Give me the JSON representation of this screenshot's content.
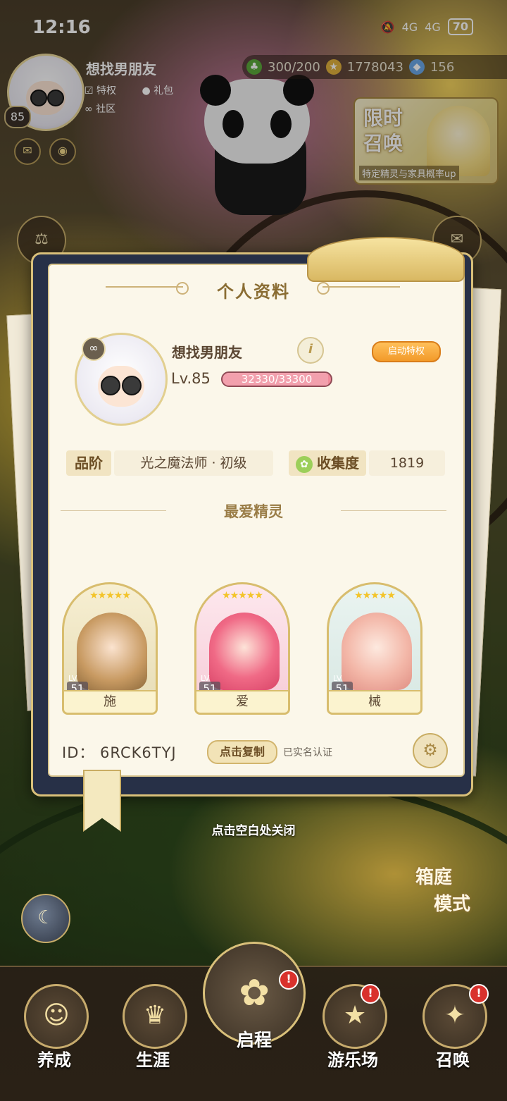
{
  "status_bar": {
    "time": "12:16",
    "signal_1": "4G",
    "signal_2": "4G",
    "battery": "70"
  },
  "top_profile": {
    "name": "想找男朋友",
    "level": "85",
    "links": [
      "特权",
      "礼包",
      "社区"
    ]
  },
  "resources": {
    "clover": "300/200",
    "coins": "1778043",
    "gems": "156"
  },
  "limited_summon": {
    "title_line1": "限时",
    "title_line2": "召唤",
    "subtitle": "特定精灵与家具概率up"
  },
  "profile_panel": {
    "title": "个人资料",
    "name": "想找男朋友",
    "level_label": "Lv.85",
    "exp_text": "32330/33300",
    "exp_fraction": 0.971,
    "privilege_button": "启动特权",
    "rank_label": "品阶",
    "rank_value": "光之魔法师 · 初级",
    "collection_label": "收集度",
    "collection_value": "1819",
    "favorites_title": "最爱精灵",
    "favorites": [
      {
        "name": "施",
        "lv_label": "LV",
        "level": "51",
        "stars": "★★★★★"
      },
      {
        "name": "爱",
        "lv_label": "LV",
        "level": "51",
        "stars": "★★★★★"
      },
      {
        "name": "械",
        "lv_label": "LV",
        "level": "51",
        "stars": "★★★★★"
      }
    ],
    "id_label": "ID：  6RCK6TYJ",
    "copy_button": "点击复制",
    "verified_text": "已实名认证"
  },
  "close_hint": "点击空白处关闭",
  "garden_mode": {
    "line1": "箱庭",
    "line2": "模式"
  },
  "bottom_nav": [
    {
      "label": "养成",
      "alert": false
    },
    {
      "label": "生涯",
      "alert": false
    },
    {
      "label": "启程",
      "alert": true
    },
    {
      "label": "游乐场",
      "alert": true
    },
    {
      "label": "召唤",
      "alert": true
    }
  ],
  "alert_glyph": "!",
  "colors": {
    "accent_gold": "#d9c07a",
    "exp_pink": "#ef8a9a",
    "privilege_orange": "#f29a2a",
    "alert_red": "#d9312c"
  }
}
